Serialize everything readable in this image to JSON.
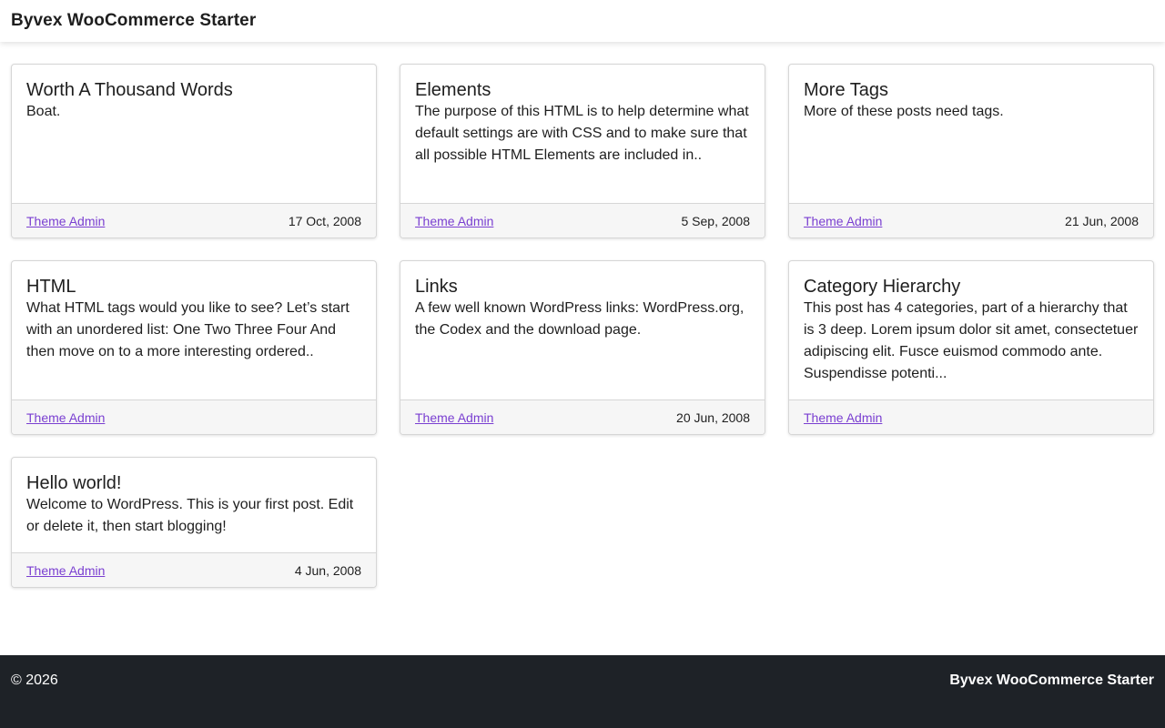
{
  "header": {
    "site_title": "Byvex WooCommerce Starter"
  },
  "posts": [
    {
      "title": "Worth A Thousand Words",
      "excerpt": "Boat.",
      "author": "Theme Admin",
      "date": "17 Oct, 2008"
    },
    {
      "title": "Elements",
      "excerpt": "The purpose of this HTML is to help determine what default settings are with CSS and to make sure that all possible HTML Elements are included in..",
      "author": "Theme Admin",
      "date": "5 Sep, 2008"
    },
    {
      "title": "More Tags",
      "excerpt": "More of these posts need tags.",
      "author": "Theme Admin",
      "date": "21 Jun, 2008"
    },
    {
      "title": "HTML",
      "excerpt": "What HTML tags would you like to see? Let’s start with an unordered list: One Two Three Four And then move on to a more interesting ordered..",
      "author": "Theme Admin",
      "date": ""
    },
    {
      "title": "Links",
      "excerpt": "A few well known WordPress links: WordPress.org, the Codex and the download page.",
      "author": "Theme Admin",
      "date": "20 Jun, 2008"
    },
    {
      "title": "Category Hierarchy",
      "excerpt": "This post has 4 categories, part of a hierarchy that is 3 deep. Lorem ipsum dolor sit amet, consectetuer adipiscing elit. Fusce euismod commodo ante. Suspendisse potenti...",
      "author": "Theme Admin",
      "date": ""
    },
    {
      "title": "Hello world!",
      "excerpt": "Welcome to WordPress. This is your first post. Edit or delete it, then start blogging!",
      "author": "Theme Admin",
      "date": "4 Jun, 2008"
    }
  ],
  "footer": {
    "copyright": "© 2026",
    "brand": "Byvex WooCommerce Starter"
  },
  "colors": {
    "link": "#7a3fd1",
    "footer_bg": "#1e2227",
    "card_footer_bg": "#f6f6f6"
  }
}
